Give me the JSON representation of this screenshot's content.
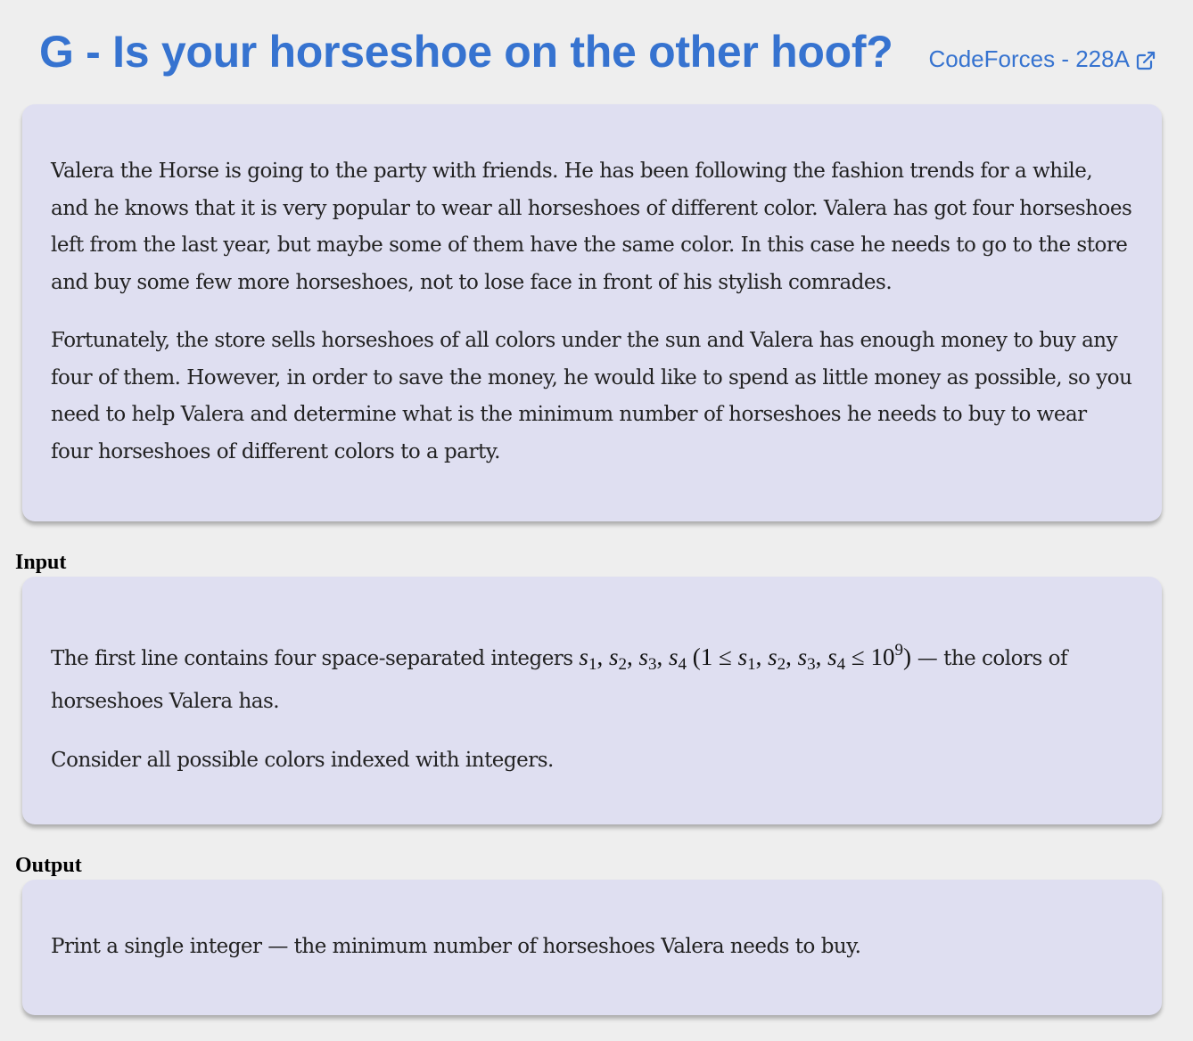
{
  "header": {
    "title": "G - Is your horseshoe on the other hoof?",
    "source_link": "CodeForces - 228A",
    "link_icon": "external-link-icon",
    "accent_color": "#3673d0"
  },
  "statement": {
    "paragraphs": [
      "Valera the Horse is going to the party with friends. He has been following the fashion trends for a while, and he knows that it is very popular to wear all horseshoes of different color. Valera has got four horseshoes left from the last year, but maybe some of them have the same color. In this case he needs to go to the store and buy some few more horseshoes, not to lose face in front of his stylish comrades.",
      "Fortunately, the store sells horseshoes of all colors under the sun and Valera has enough money to buy any four of them. However, in order to save the money, he would like to spend as little money as possible, so you need to help Valera and determine what is the minimum number of horseshoes he needs to buy to wear four horseshoes of different colors to a party."
    ]
  },
  "input": {
    "label": "Input",
    "line1_prefix": "The first line contains four space-separated integers",
    "line1_suffix": "— the colors of horseshoes Valera has.",
    "math": {
      "var": "s",
      "subs": [
        "1",
        "2",
        "3",
        "4"
      ],
      "sep": ",",
      "open": "(1",
      "le": "≤",
      "bound": "10",
      "exp": "9",
      "close": ")"
    },
    "paragraph2": "Consider all possible colors indexed with integers."
  },
  "output": {
    "label": "Output",
    "paragraph": "Print a single integer — the minimum number of horseshoes Valera needs to buy."
  },
  "colors": {
    "background": "#eeeeee",
    "card": "#dfdff1"
  }
}
